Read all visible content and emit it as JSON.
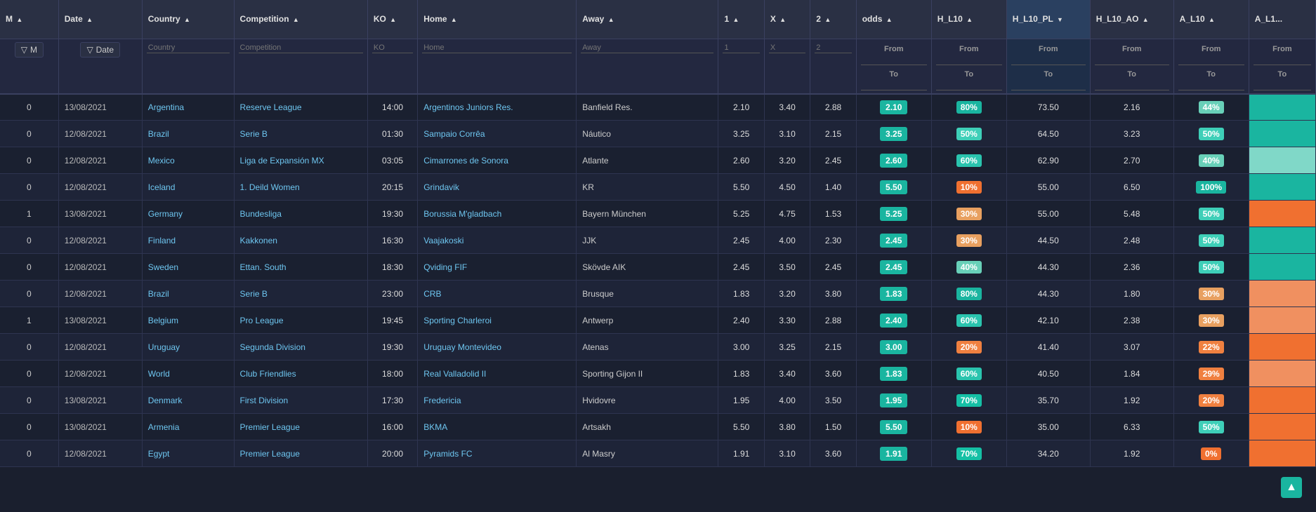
{
  "columns": {
    "m": "M",
    "date": "Date",
    "country": "Country",
    "competition": "Competition",
    "ko": "KO",
    "home": "Home",
    "away": "Away",
    "one": "1",
    "x": "X",
    "two": "2",
    "odds": "odds",
    "hl10": "H_L10",
    "hl10pl": "H_L10_PL",
    "hl10ao": "H_L10_AO",
    "al10": "A_L10",
    "al10b": "A_L1..."
  },
  "filterRow": {
    "m_label": "M",
    "date_label": "Date",
    "country_placeholder": "Country",
    "competition_placeholder": "Competition",
    "ko_placeholder": "KO",
    "home_placeholder": "Home",
    "away_placeholder": "Away",
    "one_placeholder": "1",
    "x_placeholder": "X",
    "two_placeholder": "2",
    "odds_from": "From",
    "odds_to": "To",
    "hl10_from": "From",
    "hl10_to": "To",
    "hl10pl_from": "From",
    "hl10pl_to": "To",
    "hl10ao_from": "From",
    "hl10ao_to": "To",
    "al10_from": "From",
    "al10_to": "To",
    "al10b_from": "From",
    "al10b_to": "To"
  },
  "rows": [
    {
      "m": "0",
      "date": "13/08/2021",
      "country": "Argentina",
      "competition": "Reserve League",
      "ko": "14:00",
      "home": "Argentinos Juniors Res.",
      "away": "Banfield Res.",
      "one": "2.10",
      "x": "3.40",
      "two": "2.88",
      "odds": "2.10",
      "odds_color": "teal",
      "hl10_pct": "80%",
      "hl10_color": "80",
      "hl10pl": "73.50",
      "hl10ao": "2.16",
      "al10_pct": "44%",
      "al10_color": "44",
      "al10b_color": "teal"
    },
    {
      "m": "0",
      "date": "12/08/2021",
      "country": "Brazil",
      "competition": "Serie B",
      "ko": "01:30",
      "home": "Sampaio Corrêa",
      "away": "Náutico",
      "one": "3.25",
      "x": "3.10",
      "two": "2.15",
      "odds": "3.25",
      "odds_color": "teal",
      "hl10_pct": "50%",
      "hl10_color": "50",
      "hl10pl": "64.50",
      "hl10ao": "3.23",
      "al10_pct": "50%",
      "al10_color": "50",
      "al10b_color": "teal"
    },
    {
      "m": "0",
      "date": "12/08/2021",
      "country": "Mexico",
      "competition": "Liga de Expansión MX",
      "ko": "03:05",
      "home": "Cimarrones de Sonora",
      "away": "Atlante",
      "one": "2.60",
      "x": "3.20",
      "two": "2.45",
      "odds": "2.60",
      "odds_color": "teal",
      "hl10_pct": "60%",
      "hl10_color": "60",
      "hl10pl": "62.90",
      "hl10ao": "2.70",
      "al10_pct": "40%",
      "al10_color": "40",
      "al10b_color": "light-teal"
    },
    {
      "m": "0",
      "date": "12/08/2021",
      "country": "Iceland",
      "competition": "1. Deild Women",
      "ko": "20:15",
      "home": "Grindavik",
      "away": "KR",
      "one": "5.50",
      "x": "4.50",
      "two": "1.40",
      "odds": "5.50",
      "odds_color": "teal",
      "hl10_pct": "10%",
      "hl10_color": "10",
      "hl10pl": "55.00",
      "hl10ao": "6.50",
      "al10_pct": "100%",
      "al10_color": "100",
      "al10b_color": "teal"
    },
    {
      "m": "1",
      "date": "13/08/2021",
      "country": "Germany",
      "competition": "Bundesliga",
      "ko": "19:30",
      "home": "Borussia M'gladbach",
      "away": "Bayern München",
      "one": "5.25",
      "x": "4.75",
      "two": "1.53",
      "odds": "5.25",
      "odds_color": "teal",
      "hl10_pct": "30%",
      "hl10_color": "30",
      "hl10pl": "55.00",
      "hl10ao": "5.48",
      "al10_pct": "50%",
      "al10_color": "50",
      "al10b_color": "orange"
    },
    {
      "m": "0",
      "date": "12/08/2021",
      "country": "Finland",
      "competition": "Kakkonen",
      "ko": "16:30",
      "home": "Vaajakoski",
      "away": "JJK",
      "one": "2.45",
      "x": "4.00",
      "two": "2.30",
      "odds": "2.45",
      "odds_color": "teal",
      "hl10_pct": "30%",
      "hl10_color": "30",
      "hl10pl": "44.50",
      "hl10ao": "2.48",
      "al10_pct": "50%",
      "al10_color": "50",
      "al10b_color": "teal"
    },
    {
      "m": "0",
      "date": "12/08/2021",
      "country": "Sweden",
      "competition": "Ettan. South",
      "ko": "18:30",
      "home": "Qviding FIF",
      "away": "Skövde AIK",
      "one": "2.45",
      "x": "3.50",
      "two": "2.45",
      "odds": "2.45",
      "odds_color": "teal",
      "hl10_pct": "40%",
      "hl10_color": "40",
      "hl10pl": "44.30",
      "hl10ao": "2.36",
      "al10_pct": "50%",
      "al10_color": "50",
      "al10b_color": "teal"
    },
    {
      "m": "0",
      "date": "12/08/2021",
      "country": "Brazil",
      "competition": "Serie B",
      "ko": "23:00",
      "home": "CRB",
      "away": "Brusque",
      "one": "1.83",
      "x": "3.20",
      "two": "3.80",
      "odds": "1.83",
      "odds_color": "teal",
      "hl10_pct": "80%",
      "hl10_color": "80",
      "hl10pl": "44.30",
      "hl10ao": "1.80",
      "al10_pct": "30%",
      "al10_color": "30",
      "al10b_color": "light-orange"
    },
    {
      "m": "1",
      "date": "13/08/2021",
      "country": "Belgium",
      "competition": "Pro League",
      "ko": "19:45",
      "home": "Sporting Charleroi",
      "away": "Antwerp",
      "one": "2.40",
      "x": "3.30",
      "two": "2.88",
      "odds": "2.40",
      "odds_color": "teal",
      "hl10_pct": "60%",
      "hl10_color": "60",
      "hl10pl": "42.10",
      "hl10ao": "2.38",
      "al10_pct": "30%",
      "al10_color": "30",
      "al10b_color": "light-orange"
    },
    {
      "m": "0",
      "date": "12/08/2021",
      "country": "Uruguay",
      "competition": "Segunda Division",
      "ko": "19:30",
      "home": "Uruguay Montevideo",
      "away": "Atenas",
      "one": "3.00",
      "x": "3.25",
      "two": "2.15",
      "odds": "3.00",
      "odds_color": "teal",
      "hl10_pct": "20%",
      "hl10_color": "20",
      "hl10pl": "41.40",
      "hl10ao": "3.07",
      "al10_pct": "22%",
      "al10_color": "22",
      "al10b_color": "orange"
    },
    {
      "m": "0",
      "date": "12/08/2021",
      "country": "World",
      "competition": "Club Friendlies",
      "ko": "18:00",
      "home": "Real Valladolid II",
      "away": "Sporting Gijon II",
      "one": "1.83",
      "x": "3.40",
      "two": "3.60",
      "odds": "1.83",
      "odds_color": "teal",
      "hl10_pct": "60%",
      "hl10_color": "60",
      "hl10pl": "40.50",
      "hl10ao": "1.84",
      "al10_pct": "29%",
      "al10_color": "29",
      "al10b_color": "light-orange"
    },
    {
      "m": "0",
      "date": "13/08/2021",
      "country": "Denmark",
      "competition": "First Division",
      "ko": "17:30",
      "home": "Fredericia",
      "away": "Hvidovre",
      "one": "1.95",
      "x": "4.00",
      "two": "3.50",
      "odds": "1.95",
      "odds_color": "teal",
      "hl10_pct": "70%",
      "hl10_color": "70",
      "hl10pl": "35.70",
      "hl10ao": "1.92",
      "al10_pct": "20%",
      "al10_color": "20",
      "al10b_color": "orange"
    },
    {
      "m": "0",
      "date": "13/08/2021",
      "country": "Armenia",
      "competition": "Premier League",
      "ko": "16:00",
      "home": "BKMA",
      "away": "Artsakh",
      "one": "5.50",
      "x": "3.80",
      "two": "1.50",
      "odds": "5.50",
      "odds_color": "teal",
      "hl10_pct": "10%",
      "hl10_color": "10",
      "hl10pl": "35.00",
      "hl10ao": "6.33",
      "al10_pct": "50%",
      "al10_color": "50",
      "al10b_color": "orange"
    },
    {
      "m": "0",
      "date": "12/08/2021",
      "country": "Egypt",
      "competition": "Premier League",
      "ko": "20:00",
      "home": "Pyramids FC",
      "away": "Al Masry",
      "one": "1.91",
      "x": "3.10",
      "two": "3.60",
      "odds": "1.91",
      "odds_color": "teal",
      "hl10_pct": "70%",
      "hl10_color": "70",
      "hl10pl": "34.20",
      "hl10ao": "1.92",
      "al10_pct": "0%",
      "al10_color": "0",
      "al10b_color": "orange"
    }
  ],
  "scroll_top_label": "▲"
}
